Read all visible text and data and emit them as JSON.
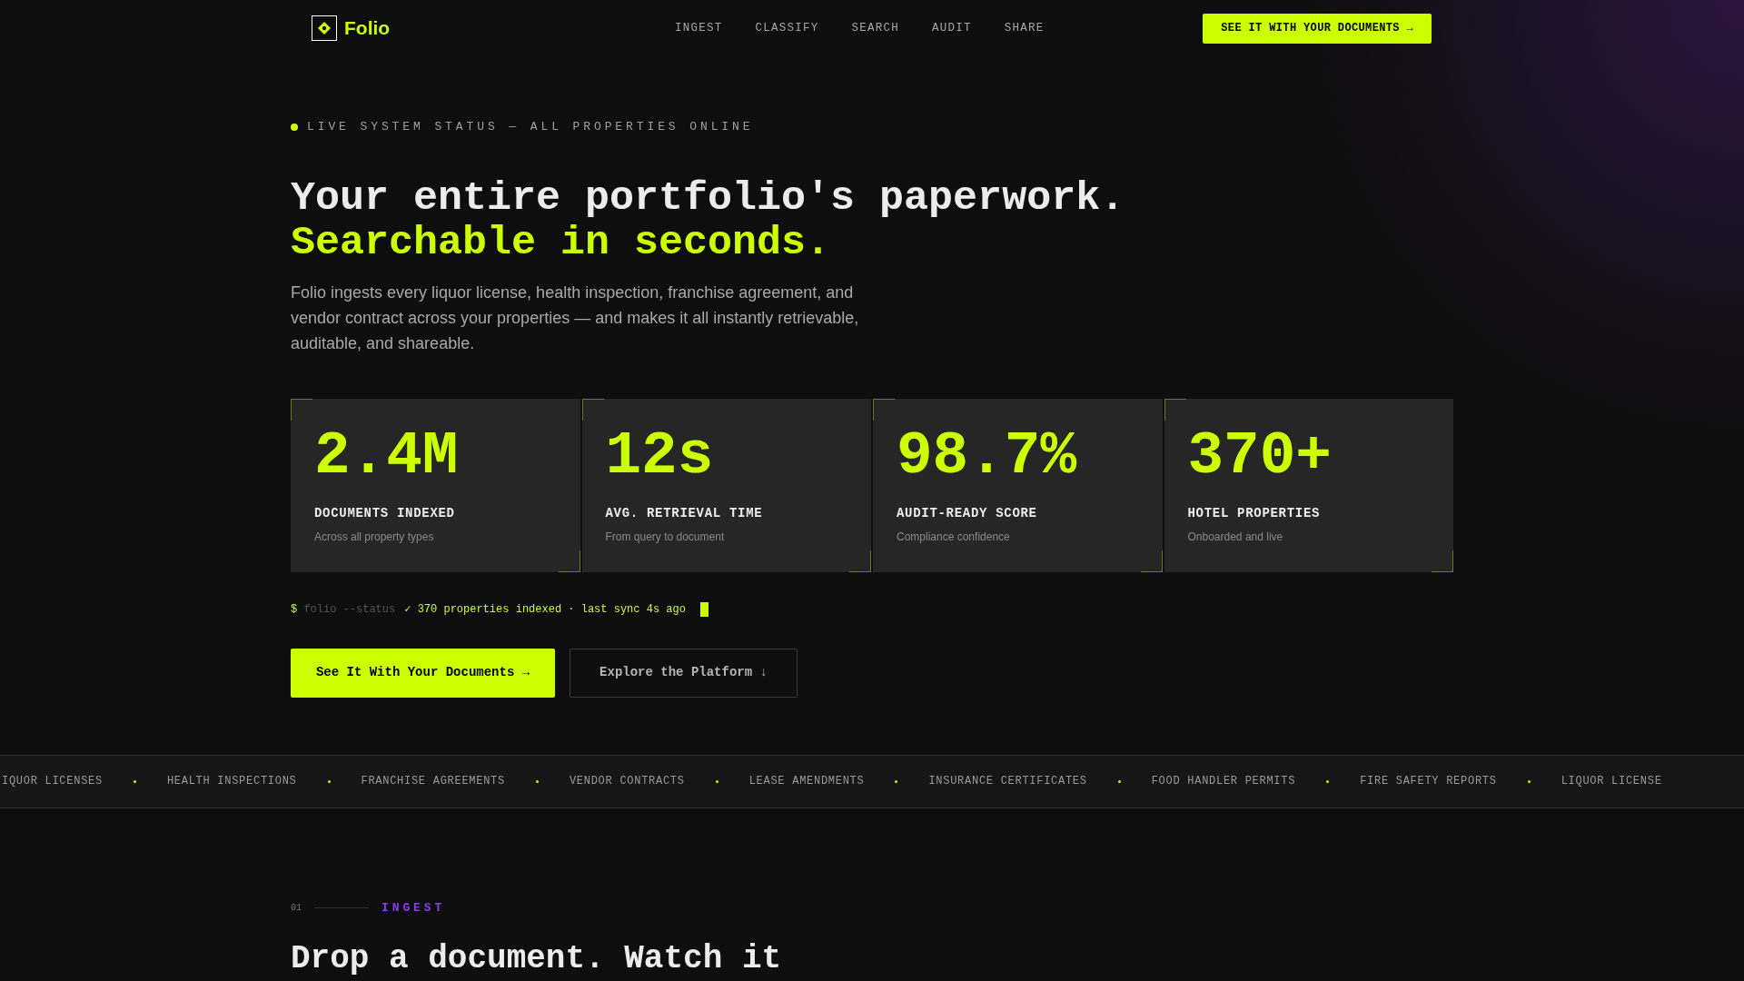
{
  "nav": {
    "brand": "Folio",
    "links": [
      "INGEST",
      "CLASSIFY",
      "SEARCH",
      "AUDIT",
      "SHARE"
    ],
    "cta": "SEE IT WITH YOUR DOCUMENTS →"
  },
  "hero": {
    "status": "LIVE SYSTEM STATUS — ALL PROPERTIES ONLINE",
    "headline": [
      {
        "text": "Your entire portfolio's paperwork.",
        "accent": false
      },
      {
        "text": "Searchable in seconds.",
        "accent": true
      }
    ],
    "intro": "Folio ingests every liquor license, health inspection, franchise agreement, and vendor contract across your properties — and makes it all instantly retrievable, auditable, and shareable."
  },
  "stats": [
    {
      "value": "2.4M",
      "label": "DOCUMENTS INDEXED",
      "caption": "Across all property types"
    },
    {
      "value": "12s",
      "label": "AVG. RETRIEVAL TIME",
      "caption": "From query to document"
    },
    {
      "value": "98.7%",
      "label": "AUDIT-READY SCORE",
      "caption": "Compliance confidence"
    },
    {
      "value": "370+",
      "label": "HOTEL PROPERTIES",
      "caption": "Onboarded and live"
    }
  ],
  "terminal": {
    "prompt": "$",
    "command": "folio --status",
    "output": "✓ 370 properties indexed · last sync 4s ago"
  },
  "buttons": [
    {
      "label": "See It With Your Documents →",
      "kind": "primary"
    },
    {
      "label": "Explore the Platform ↓",
      "kind": "secondary"
    }
  ],
  "ticker": [
    "IQUOR LICENSES",
    "HEALTH INSPECTIONS",
    "FRANCHISE AGREEMENTS",
    "VENDOR CONTRACTS",
    "LEASE AMENDMENTS",
    "INSURANCE CERTIFICATES",
    "FOOD HANDLER PERMITS",
    "FIRE SAFETY REPORTS",
    "LIQUOR LICENSE"
  ],
  "section": {
    "number": "01",
    "label": "INGEST",
    "title": "Drop a document. Watch it"
  }
}
